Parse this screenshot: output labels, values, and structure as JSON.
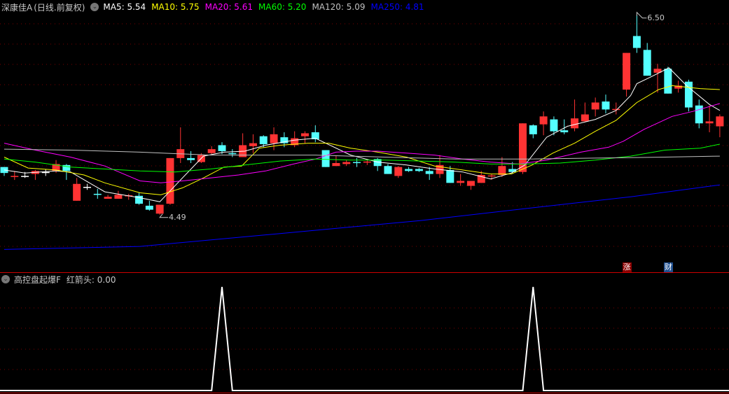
{
  "header": {
    "stock_name": "深康佳A",
    "period": "(日线.前复权)",
    "ma": [
      {
        "label": "MA5: 5.54",
        "color": "#ffffff"
      },
      {
        "label": "MA10: 5.75",
        "color": "#ffff00"
      },
      {
        "label": "MA20: 5.61",
        "color": "#ff00ff"
      },
      {
        "label": "MA60: 5.20",
        "color": "#00ff00"
      },
      {
        "label": "MA120: 5.09",
        "color": "#c0c0c0"
      },
      {
        "label": "MA250: 4.81",
        "color": "#0000ff"
      }
    ]
  },
  "indicator": {
    "name": "高控盘起爆F",
    "value_label": "红箭头: 0.00",
    "spikes_at_index": [
      21,
      51
    ]
  },
  "badges": [
    {
      "text": "涨",
      "color": "#8b0000",
      "index": 60
    },
    {
      "text": "财",
      "color": "#1f4f8f",
      "index": 64
    }
  ],
  "price_labels": {
    "high": "6.50",
    "low": "4.49"
  },
  "colors": {
    "up": "#ff3333",
    "down": "#54ffff",
    "grid": "#7a0000",
    "separator": "#cc0000"
  },
  "chart_data": {
    "type": "candlestick",
    "price_range": [
      4.05,
      6.65
    ],
    "candles": [
      [
        4.97,
        4.97,
        4.88,
        4.91
      ],
      [
        4.87,
        4.93,
        4.84,
        4.88
      ],
      [
        4.88,
        4.92,
        4.86,
        4.88
      ],
      [
        4.9,
        4.94,
        4.84,
        4.93
      ],
      [
        4.92,
        4.95,
        4.88,
        4.92
      ],
      [
        4.93,
        5.04,
        4.91,
        5.0
      ],
      [
        4.99,
        5.0,
        4.84,
        4.93
      ],
      [
        4.63,
        4.86,
        4.63,
        4.8
      ],
      [
        4.77,
        4.8,
        4.74,
        4.77
      ],
      [
        4.7,
        4.75,
        4.65,
        4.695
      ],
      [
        4.65,
        4.69,
        4.65,
        4.67
      ],
      [
        4.65,
        4.73,
        4.65,
        4.69
      ],
      [
        4.68,
        4.7,
        4.64,
        4.685
      ],
      [
        4.68,
        4.71,
        4.59,
        4.6
      ],
      [
        4.58,
        4.63,
        4.53,
        4.54
      ],
      [
        4.5,
        4.59,
        4.49,
        4.59
      ],
      [
        4.6,
        5.06,
        4.59,
        5.06
      ],
      [
        5.06,
        5.37,
        5.01,
        5.15
      ],
      [
        5.06,
        5.13,
        5.01,
        5.04
      ],
      [
        5.02,
        5.11,
        5.01,
        5.09
      ],
      [
        5.11,
        5.18,
        5.1,
        5.15
      ],
      [
        5.19,
        5.22,
        5.1,
        5.13
      ],
      [
        5.11,
        5.15,
        5.07,
        5.1
      ],
      [
        5.07,
        5.31,
        5.07,
        5.19
      ],
      [
        5.18,
        5.3,
        5.11,
        5.21
      ],
      [
        5.28,
        5.29,
        5.17,
        5.2
      ],
      [
        5.21,
        5.37,
        5.14,
        5.3
      ],
      [
        5.27,
        5.32,
        5.17,
        5.21
      ],
      [
        5.19,
        5.33,
        5.17,
        5.26
      ],
      [
        5.28,
        5.33,
        5.21,
        5.31
      ],
      [
        5.32,
        5.39,
        5.22,
        5.25
      ],
      [
        5.14,
        5.14,
        4.97,
        4.97
      ],
      [
        4.98,
        5.08,
        4.98,
        5.01
      ],
      [
        5.0,
        5.04,
        4.98,
        5.02
      ],
      [
        5.02,
        5.06,
        4.97,
        5.01
      ],
      [
        5.02,
        5.05,
        4.99,
        5.025
      ],
      [
        5.05,
        5.06,
        4.93,
        4.98
      ],
      [
        4.98,
        5.0,
        4.9,
        4.9
      ],
      [
        4.88,
        4.98,
        4.86,
        4.97
      ],
      [
        4.95,
        4.97,
        4.92,
        4.93
      ],
      [
        4.95,
        4.96,
        4.92,
        4.93
      ],
      [
        4.93,
        4.97,
        4.84,
        4.9
      ],
      [
        4.9,
        5.09,
        4.86,
        4.99
      ],
      [
        4.94,
        4.98,
        4.81,
        4.81
      ],
      [
        4.81,
        4.9,
        4.78,
        4.83
      ],
      [
        4.78,
        4.83,
        4.74,
        4.83
      ],
      [
        4.81,
        4.93,
        4.81,
        4.89
      ],
      [
        4.88,
        4.9,
        4.84,
        4.885
      ],
      [
        4.89,
        5.07,
        4.87,
        4.98
      ],
      [
        4.95,
        5.02,
        4.9,
        4.92
      ],
      [
        4.92,
        5.41,
        4.9,
        5.41
      ],
      [
        5.39,
        5.4,
        5.26,
        5.3
      ],
      [
        5.4,
        5.53,
        5.29,
        5.48
      ],
      [
        5.45,
        5.48,
        5.29,
        5.33
      ],
      [
        5.34,
        5.45,
        5.3,
        5.32
      ],
      [
        5.36,
        5.65,
        5.33,
        5.46
      ],
      [
        5.43,
        5.62,
        5.43,
        5.5
      ],
      [
        5.55,
        5.67,
        5.48,
        5.62
      ],
      [
        5.63,
        5.7,
        5.51,
        5.55
      ],
      [
        5.55,
        5.62,
        5.5,
        5.555
      ],
      [
        5.75,
        6.12,
        5.68,
        6.12
      ],
      [
        6.29,
        6.5,
        6.12,
        6.17
      ],
      [
        6.15,
        6.22,
        5.89,
        5.89
      ],
      [
        5.92,
        6.01,
        5.72,
        5.96
      ],
      [
        5.96,
        5.98,
        5.71,
        5.71
      ],
      [
        5.76,
        5.84,
        5.72,
        5.79
      ],
      [
        5.83,
        5.85,
        5.53,
        5.57
      ],
      [
        5.59,
        5.65,
        5.36,
        5.41
      ],
      [
        5.41,
        5.59,
        5.32,
        5.43
      ],
      [
        5.38,
        5.5,
        5.27,
        5.48
      ]
    ],
    "ma_series": [
      {
        "name": "MA5",
        "color": "#ffffff",
        "points": [
          [
            0,
            4.94
          ],
          [
            2,
            4.91
          ],
          [
            5,
            4.93
          ],
          [
            6.4,
            4.92
          ],
          [
            9.7,
            4.72
          ],
          [
            13.1,
            4.66
          ],
          [
            15,
            4.62
          ],
          [
            17,
            4.84
          ],
          [
            19.2,
            5.08
          ],
          [
            21.2,
            5.12
          ],
          [
            23.2,
            5.13
          ],
          [
            25.2,
            5.19
          ],
          [
            27.9,
            5.24
          ],
          [
            30,
            5.26
          ],
          [
            31,
            5.21
          ],
          [
            33.4,
            5.09
          ],
          [
            36,
            5.02
          ],
          [
            38.8,
            4.99
          ],
          [
            41.5,
            4.95
          ],
          [
            44.2,
            4.92
          ],
          [
            46.9,
            4.85
          ],
          [
            48.9,
            4.91
          ],
          [
            50.2,
            4.99
          ],
          [
            52.3,
            5.27
          ],
          [
            54.3,
            5.38
          ],
          [
            57,
            5.45
          ],
          [
            59,
            5.54
          ],
          [
            60.4,
            5.69
          ],
          [
            61,
            5.81
          ],
          [
            62.4,
            5.88
          ],
          [
            64.1,
            5.97
          ],
          [
            65.8,
            5.79
          ],
          [
            68,
            5.6
          ],
          [
            69,
            5.54
          ]
        ]
      },
      {
        "name": "MA10",
        "color": "#ffff00",
        "points": [
          [
            0,
            5.07
          ],
          [
            2.3,
            4.96
          ],
          [
            5,
            4.94
          ],
          [
            7.7,
            4.89
          ],
          [
            9.7,
            4.81
          ],
          [
            13.1,
            4.71
          ],
          [
            15.1,
            4.69
          ],
          [
            17.2,
            4.76
          ],
          [
            19.2,
            4.86
          ],
          [
            21.2,
            4.97
          ],
          [
            22.9,
            4.98
          ],
          [
            24.6,
            5.16
          ],
          [
            26.6,
            5.19
          ],
          [
            29.3,
            5.21
          ],
          [
            31.3,
            5.21
          ],
          [
            33.4,
            5.16
          ],
          [
            36,
            5.12
          ],
          [
            38.8,
            5.07
          ],
          [
            41.5,
            4.98
          ],
          [
            44.2,
            4.94
          ],
          [
            46.9,
            4.9
          ],
          [
            48.9,
            4.9
          ],
          [
            50.9,
            4.99
          ],
          [
            52.9,
            5.11
          ],
          [
            55,
            5.21
          ],
          [
            57,
            5.33
          ],
          [
            59,
            5.44
          ],
          [
            61,
            5.62
          ],
          [
            63.1,
            5.75
          ],
          [
            64.4,
            5.79
          ],
          [
            67.1,
            5.76
          ],
          [
            69,
            5.75
          ]
        ]
      },
      {
        "name": "MA20",
        "color": "#ff00ff",
        "points": [
          [
            0,
            5.21
          ],
          [
            3,
            5.14
          ],
          [
            6.4,
            5.07
          ],
          [
            9.7,
            4.98
          ],
          [
            13.1,
            4.83
          ],
          [
            15.1,
            4.81
          ],
          [
            17.2,
            4.83
          ],
          [
            19.9,
            4.86
          ],
          [
            22.6,
            4.89
          ],
          [
            25.2,
            4.93
          ],
          [
            27.9,
            5.0
          ],
          [
            30,
            5.05
          ],
          [
            32,
            5.12
          ],
          [
            34,
            5.13
          ],
          [
            36,
            5.13
          ],
          [
            38.8,
            5.11
          ],
          [
            41.5,
            5.09
          ],
          [
            44.2,
            5.05
          ],
          [
            46.9,
            5.02
          ],
          [
            49.6,
            5.0
          ],
          [
            52.3,
            5.04
          ],
          [
            55.6,
            5.12
          ],
          [
            58.3,
            5.17
          ],
          [
            59.7,
            5.23
          ],
          [
            61.7,
            5.35
          ],
          [
            64.4,
            5.48
          ],
          [
            66.4,
            5.53
          ],
          [
            69,
            5.61
          ]
        ]
      },
      {
        "name": "MA60",
        "color": "#00ff00",
        "points": [
          [
            0,
            5.05
          ],
          [
            3,
            5.02
          ],
          [
            6.4,
            4.97
          ],
          [
            9.7,
            4.95
          ],
          [
            13.1,
            4.93
          ],
          [
            16.5,
            4.92
          ],
          [
            19.9,
            4.95
          ],
          [
            23.2,
            4.99
          ],
          [
            26.6,
            5.03
          ],
          [
            30,
            5.05
          ],
          [
            33.4,
            5.04
          ],
          [
            36.7,
            5.04
          ],
          [
            40.1,
            5.03
          ],
          [
            43.5,
            5.02
          ],
          [
            46.9,
            5.0
          ],
          [
            50.2,
            5.0
          ],
          [
            53.6,
            5.01
          ],
          [
            57,
            5.04
          ],
          [
            60.4,
            5.08
          ],
          [
            63.7,
            5.14
          ],
          [
            67.1,
            5.16
          ],
          [
            69,
            5.2
          ]
        ]
      },
      {
        "name": "MA120",
        "color": "#c0c0c0",
        "points": [
          [
            0,
            5.15
          ],
          [
            6.4,
            5.14
          ],
          [
            13.1,
            5.12
          ],
          [
            19.9,
            5.09
          ],
          [
            30,
            5.09
          ],
          [
            36.7,
            5.07
          ],
          [
            43.5,
            5.05
          ],
          [
            50.2,
            5.05
          ],
          [
            57,
            5.06
          ],
          [
            63.7,
            5.07
          ],
          [
            69,
            5.08
          ]
        ]
      },
      {
        "name": "MA250",
        "color": "#0000ff",
        "points": [
          [
            0,
            4.14
          ],
          [
            13.1,
            4.17
          ],
          [
            26.6,
            4.3
          ],
          [
            40.1,
            4.43
          ],
          [
            53.6,
            4.59
          ],
          [
            60.4,
            4.67
          ],
          [
            69,
            4.79
          ]
        ]
      }
    ],
    "high_marker": {
      "index": 61,
      "value": 6.5
    },
    "low_marker": {
      "index": 15,
      "value": 4.49
    }
  }
}
